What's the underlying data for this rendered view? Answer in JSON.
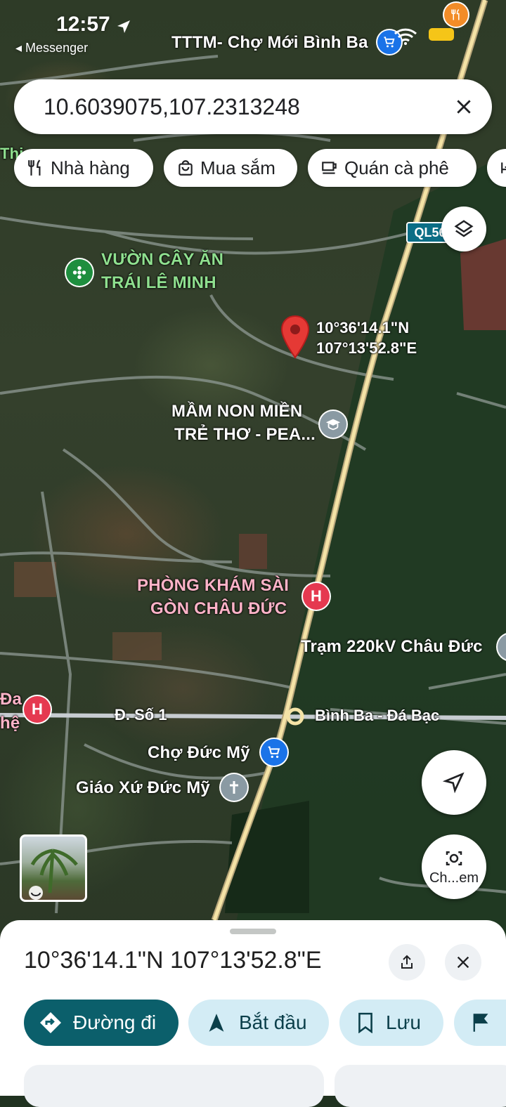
{
  "status_bar": {
    "time": "12:57",
    "back_app": "Messenger"
  },
  "search": {
    "query": "10.6039075,107.2313248"
  },
  "chips": [
    {
      "label": "Nhà hàng",
      "icon": "restaurant-icon"
    },
    {
      "label": "Mua sắm",
      "icon": "shopping-bag-icon"
    },
    {
      "label": "Quán cà phê",
      "icon": "coffee-cup-icon"
    }
  ],
  "map": {
    "route_badge": "QL56",
    "top_place": "TTTM- Chợ Mới Bình Ba",
    "places": {
      "orchard_line1": "VƯỜN CÂY ĂN",
      "orchard_line2": "TRÁI LÊ MINH",
      "school_line1": "MẦM NON MIỀN",
      "school_line2": "TRẺ THƠ - PEA...",
      "clinic_line1": "PHÒNG KHÁM SÀI",
      "clinic_line2": "GÒN CHÂU ĐỨC",
      "substation": "Trạm 220kV Châu Đức",
      "market": "Chợ Đức Mỹ",
      "church": "Giáo Xứ Đức Mỹ",
      "left_edge_1": "Đa",
      "left_edge_2": "hệ",
      "left_top_edge": "Thi"
    },
    "roads": {
      "road_so1": "Đ. Số 1",
      "road_binh_ba": "Bình Ba - Đá Bạc"
    },
    "pin": {
      "lat": "10°36'14.1\"N",
      "lng": "107°13'52.8\"E"
    },
    "camera_label": "Ch...em"
  },
  "sheet": {
    "coordinates": "10°36'14.1\"N 107°13'52.8\"E",
    "actions": {
      "directions": "Đường đi",
      "start": "Bắt đầu",
      "save": "Lưu"
    }
  },
  "colors": {
    "accent": "#0b5f6b",
    "action_bg": "#d3ecf5",
    "pin": "#e53935",
    "hospital": "#e53950",
    "shopping": "#1a73e8",
    "poi_grey": "#8a9aa3",
    "poi_green": "#1e8e3e"
  }
}
